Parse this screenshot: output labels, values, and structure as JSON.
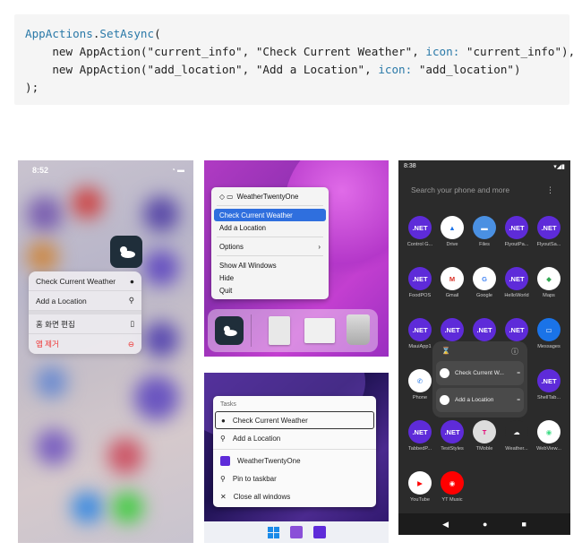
{
  "code": {
    "line1_class": "AppActions",
    "line1_method": "SetAsync",
    "line2_prefix": "    new AppAction(",
    "line2_id": "\"current_info\"",
    "line2_title": "\"Check Current Weather\"",
    "line2_icon_kw": "icon:",
    "line2_icon": "\"current_info\"",
    "line3_prefix": "    new AppAction(",
    "line3_id": "\"add_location\"",
    "line3_title": "\"Add a Location\"",
    "line3_icon_kw": "icon:",
    "line3_icon": "\"add_location\"",
    "line4": ");"
  },
  "ios": {
    "time": "8:52",
    "menu": [
      {
        "label": "Check Current Weather",
        "icon": "●"
      },
      {
        "label": "Add a Location",
        "icon": "⚲"
      },
      {
        "label": "홈 화면 편집",
        "icon": "▯"
      },
      {
        "label": "앱 제거",
        "icon": "⊖"
      }
    ]
  },
  "mac": {
    "title": "WeatherTwentyOne",
    "items": [
      "Check Current Weather",
      "Add a Location",
      "Options",
      "Show All Windows",
      "Hide",
      "Quit"
    ]
  },
  "win": {
    "section": "Tasks",
    "items": [
      "Check Current Weather",
      "Add a Location",
      "WeatherTwentyOne",
      "Pin to taskbar",
      "Close all windows"
    ]
  },
  "android": {
    "time": "8:38",
    "search": "Search your phone and more",
    "apps": [
      [
        "Control G...",
        "Drive",
        "Files",
        "FlyoutPa...",
        "FlyoutSa..."
      ],
      [
        "FoodPOS",
        "Gmail",
        "Google",
        "HelloWorld",
        "Maps"
      ],
      [
        "MauiApp1",
        "",
        "",
        "",
        "Messages"
      ],
      [
        "Phone",
        "",
        "",
        "",
        "ShellTab..."
      ],
      [
        "TabbedP...",
        "TestStyles",
        "TMoble",
        "Weather...",
        "WebView..."
      ],
      [
        "YouTube",
        "YT Music",
        "",
        "",
        ""
      ]
    ],
    "popup": [
      "Check Current W...",
      "Add a Location"
    ],
    "net_label": ".NET"
  }
}
